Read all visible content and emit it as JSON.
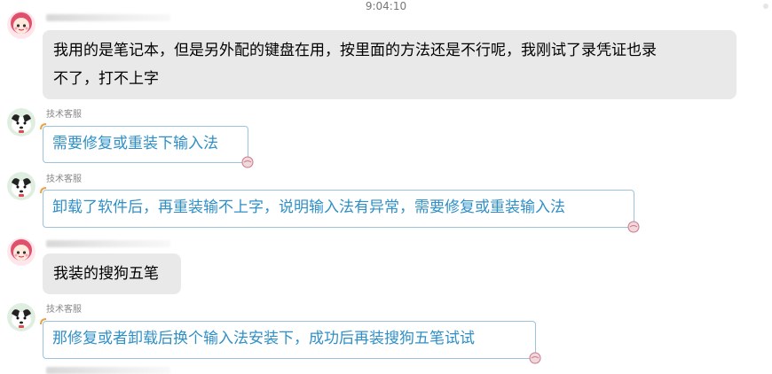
{
  "header": {
    "time": "9:04:10"
  },
  "colors": {
    "agent_text": "#2f8fc6",
    "agent_border": "#9cc3dd",
    "user_bubble": "#e9e9e9"
  },
  "messages": [
    {
      "role": "user",
      "sender": "",
      "avatar": "girl-avatar-icon",
      "lines": [
        "我用的是笔记本，但是另外配的键盘在用，按里面的方法还是不行呢，我刚试了录凭证也录",
        "不了，打不上字"
      ]
    },
    {
      "role": "agent",
      "sender": "技术客服",
      "avatar": "dog-avatar-icon",
      "text": "需要修复或重装下输入法"
    },
    {
      "role": "agent",
      "sender": "技术客服",
      "avatar": "dog-avatar-icon",
      "text": "卸载了软件后，再重装输不上字，说明输入法有异常，需要修复或重装输入法"
    },
    {
      "role": "user",
      "sender": "",
      "avatar": "girl-avatar-icon",
      "text": "我装的搜狗五笔"
    },
    {
      "role": "agent",
      "sender": "技术客服",
      "avatar": "dog-avatar-icon",
      "text": "那修复或者卸载后换个输入法安装下，成功后再装搜狗五笔试试"
    }
  ]
}
